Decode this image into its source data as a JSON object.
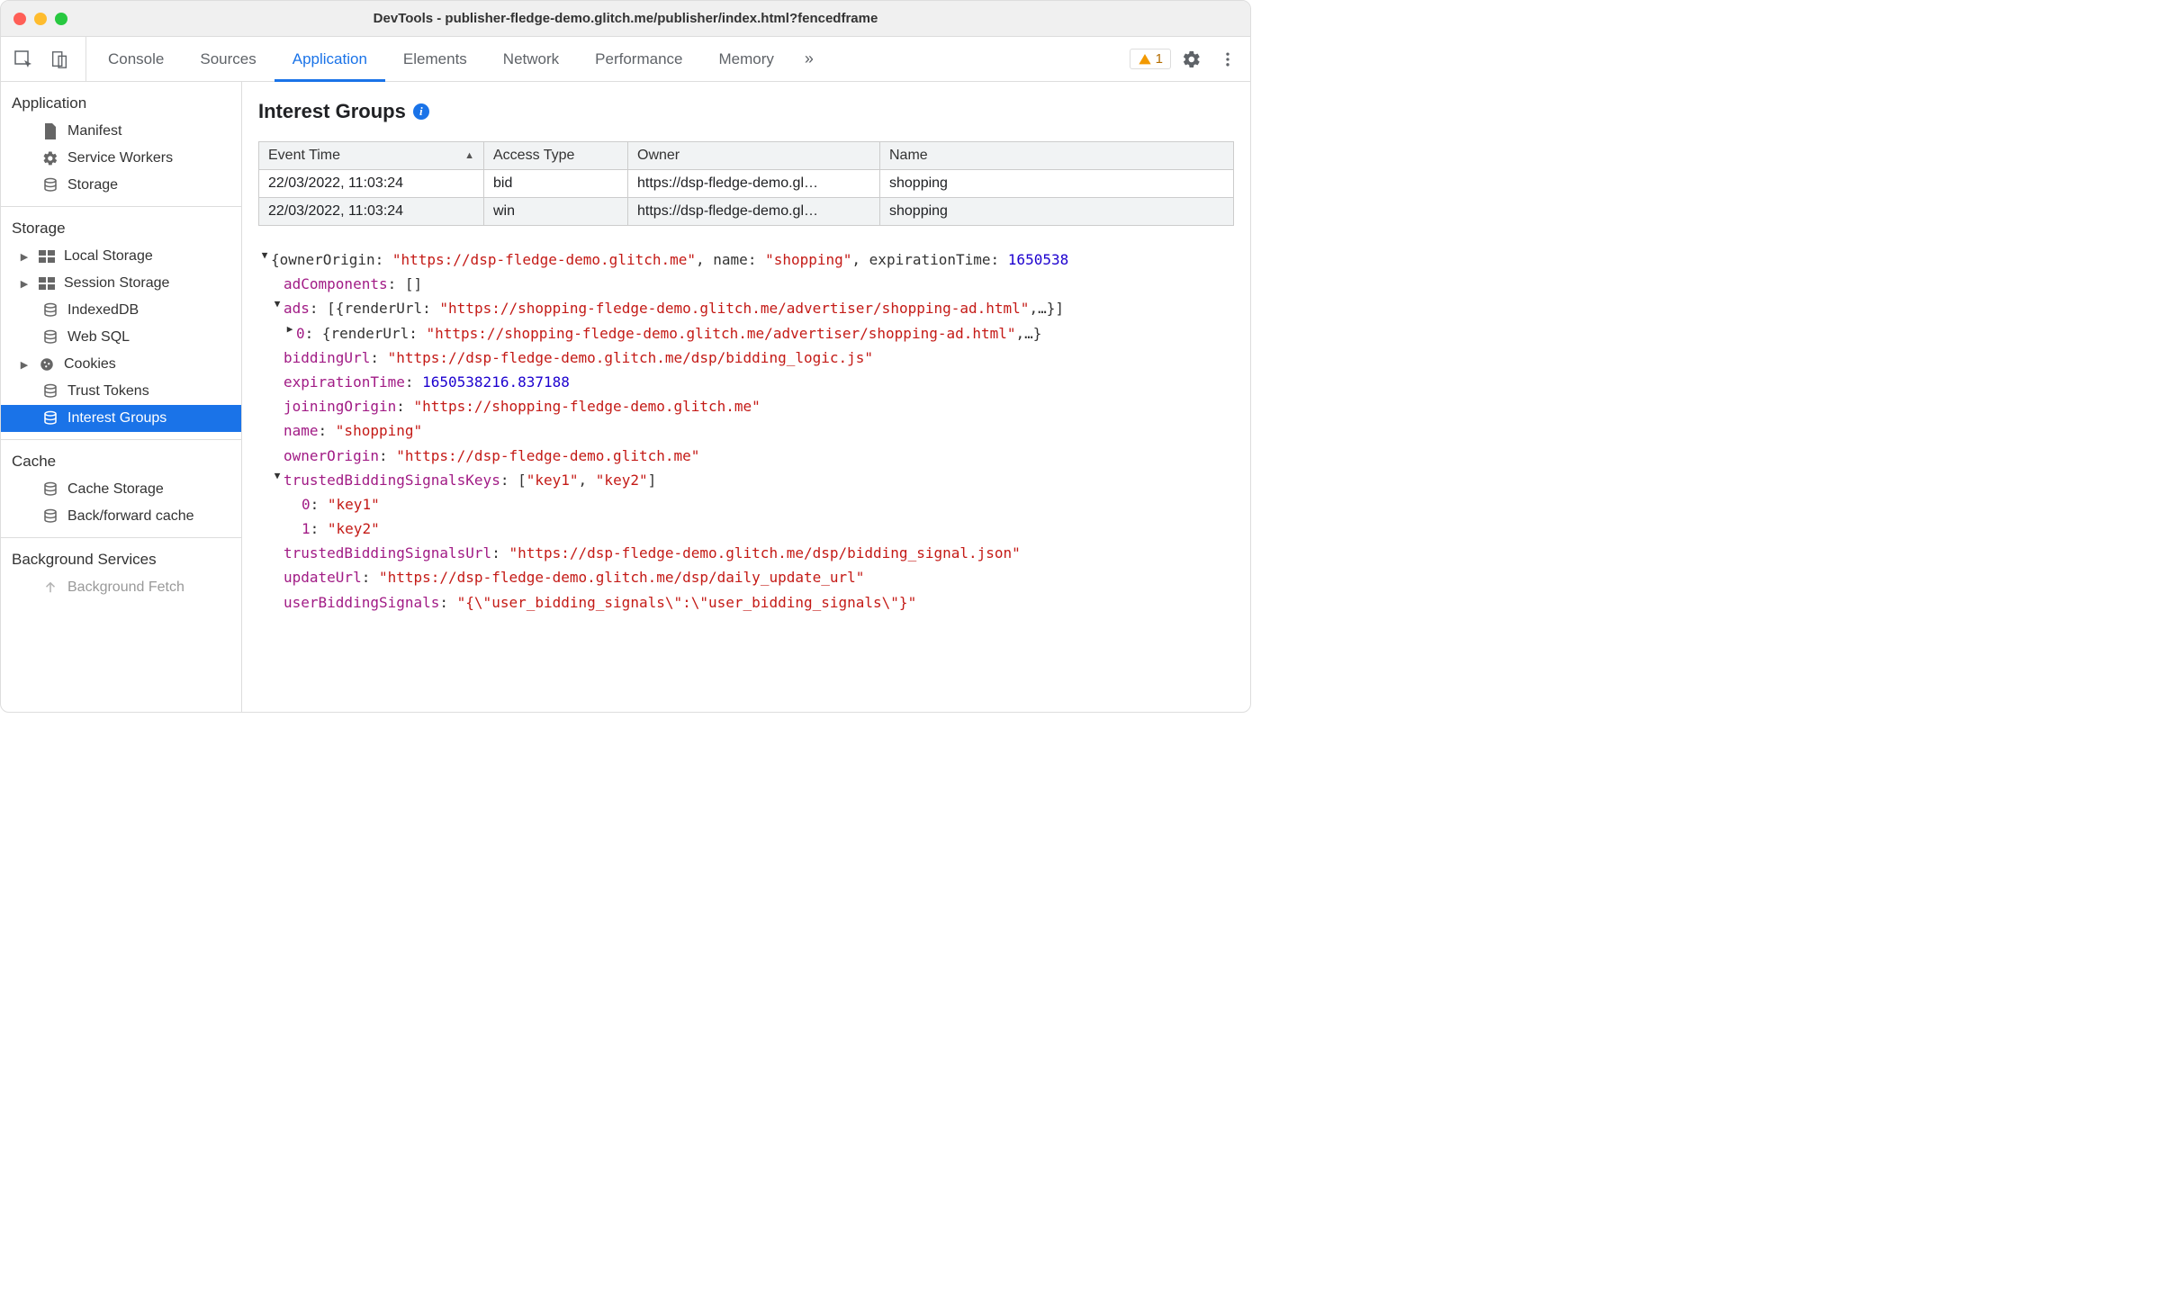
{
  "window": {
    "title": "DevTools - publisher-fledge-demo.glitch.me/publisher/index.html?fencedframe"
  },
  "tabs": {
    "items": [
      "Console",
      "Sources",
      "Application",
      "Elements",
      "Network",
      "Performance",
      "Memory"
    ],
    "overflow": "»",
    "active": "Application",
    "warning_count": "1"
  },
  "sidebar": {
    "application": {
      "title": "Application",
      "items": [
        {
          "label": "Manifest"
        },
        {
          "label": "Service Workers"
        },
        {
          "label": "Storage"
        }
      ]
    },
    "storage": {
      "title": "Storage",
      "items": [
        {
          "label": "Local Storage",
          "expandable": true
        },
        {
          "label": "Session Storage",
          "expandable": true
        },
        {
          "label": "IndexedDB"
        },
        {
          "label": "Web SQL"
        },
        {
          "label": "Cookies",
          "expandable": true
        },
        {
          "label": "Trust Tokens"
        },
        {
          "label": "Interest Groups",
          "selected": true
        }
      ]
    },
    "cache": {
      "title": "Cache",
      "items": [
        {
          "label": "Cache Storage"
        },
        {
          "label": "Back/forward cache"
        }
      ]
    },
    "background": {
      "title": "Background Services",
      "items": [
        {
          "label": "Background Fetch"
        }
      ]
    }
  },
  "panel": {
    "title": "Interest Groups",
    "table": {
      "headers": [
        "Event Time",
        "Access Type",
        "Owner",
        "Name"
      ],
      "rows": [
        [
          "22/03/2022, 11:03:24",
          "bid",
          "https://dsp-fledge-demo.gl…",
          "shopping"
        ],
        [
          "22/03/2022, 11:03:24",
          "win",
          "https://dsp-fledge-demo.gl…",
          "shopping"
        ]
      ]
    },
    "detail": {
      "root_summary_prefix": "{ownerOrigin: ",
      "root_summary_owner": "\"https://dsp-fledge-demo.glitch.me\"",
      "root_summary_mid": ", name: ",
      "root_summary_name": "\"shopping\"",
      "root_summary_suffix": ", expirationTime: ",
      "root_summary_time": "1650538",
      "adComponents_key": "adComponents",
      "adComponents_val": "[]",
      "ads_key": "ads",
      "ads_val_prefix": "[{renderUrl: ",
      "ads_val_str": "\"https://shopping-fledge-demo.glitch.me/advertiser/shopping-ad.html\"",
      "ads_val_suffix": ",…}]",
      "ads0_key": "0",
      "ads0_val_prefix": "{renderUrl: ",
      "ads0_val_str": "\"https://shopping-fledge-demo.glitch.me/advertiser/shopping-ad.html\"",
      "ads0_val_suffix": ",…}",
      "biddingUrl_key": "biddingUrl",
      "biddingUrl_val": "\"https://dsp-fledge-demo.glitch.me/dsp/bidding_logic.js\"",
      "expirationTime_key": "expirationTime",
      "expirationTime_val": "1650538216.837188",
      "joiningOrigin_key": "joiningOrigin",
      "joiningOrigin_val": "\"https://shopping-fledge-demo.glitch.me\"",
      "name_key": "name",
      "name_val": "\"shopping\"",
      "ownerOrigin_key": "ownerOrigin",
      "ownerOrigin_val": "\"https://dsp-fledge-demo.glitch.me\"",
      "tbsk_key": "trustedBiddingSignalsKeys",
      "tbsk_val_prefix": "[",
      "tbsk_val_0": "\"key1\"",
      "tbsk_val_sep": ", ",
      "tbsk_val_1": "\"key2\"",
      "tbsk_val_suffix": "]",
      "tbsk_item0_key": "0",
      "tbsk_item0_val": "\"key1\"",
      "tbsk_item1_key": "1",
      "tbsk_item1_val": "\"key2\"",
      "tbsu_key": "trustedBiddingSignalsUrl",
      "tbsu_val": "\"https://dsp-fledge-demo.glitch.me/dsp/bidding_signal.json\"",
      "updateUrl_key": "updateUrl",
      "updateUrl_val": "\"https://dsp-fledge-demo.glitch.me/dsp/daily_update_url\"",
      "ubs_key": "userBiddingSignals",
      "ubs_val": "\"{\\\"user_bidding_signals\\\":\\\"user_bidding_signals\\\"}\""
    }
  }
}
